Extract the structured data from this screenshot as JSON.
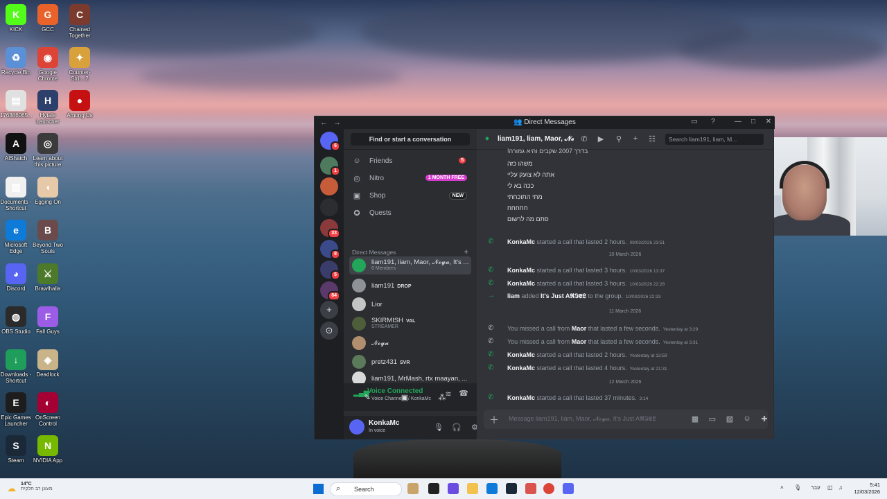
{
  "desktop": {
    "icons": [
      {
        "label": "KICK",
        "color": "#53fc18",
        "glyph": "K"
      },
      {
        "label": "GCC",
        "color": "#e8622a",
        "glyph": "G"
      },
      {
        "label": "Chained Together",
        "color": "#7a3b2e",
        "glyph": "C"
      },
      {
        "label": "Recycle Bin",
        "color": "#5b8fd6",
        "glyph": "♻"
      },
      {
        "label": "Google Chrome",
        "color": "#db4437",
        "glyph": "◉"
      },
      {
        "label": "Counter-Stri... 2",
        "color": "#d9a13b",
        "glyph": "✦"
      },
      {
        "label": "176886065...",
        "color": "#e0e0e0",
        "glyph": "▤"
      },
      {
        "label": "Hytale Launcher",
        "color": "#2d3f6b",
        "glyph": "H"
      },
      {
        "label": "Among Us",
        "color": "#c51111",
        "glyph": "●"
      },
      {
        "label": "AIShatch",
        "color": "#111111",
        "glyph": "A"
      },
      {
        "label": "Learn about this picture",
        "color": "#3b3b3b",
        "glyph": "◎"
      },
      {
        "label": "Documents - Shortcut",
        "color": "#f0f0f0",
        "glyph": "▥"
      },
      {
        "label": "Egging On",
        "color": "#e6c9a8",
        "glyph": "◖"
      },
      {
        "label": "Microsoft Edge",
        "color": "#0f7bd8",
        "glyph": "e"
      },
      {
        "label": "Beyond Two Souls",
        "color": "#6a4a4a",
        "glyph": "B"
      },
      {
        "label": "Discord",
        "color": "#5865f2",
        "glyph": "◕"
      },
      {
        "label": "Brawlhalla",
        "color": "#4c7a2a",
        "glyph": "⚔"
      },
      {
        "label": "OBS Studio",
        "color": "#2b2b2b",
        "glyph": "◍"
      },
      {
        "label": "Fall Guys",
        "color": "#9b5de5",
        "glyph": "F"
      },
      {
        "label": "Downloads - Shortcut",
        "color": "#1e9e5a",
        "glyph": "↓"
      },
      {
        "label": "Deadlock",
        "color": "#c9b48a",
        "glyph": "◈"
      },
      {
        "label": "Epic Games Launcher",
        "color": "#1d1d1d",
        "glyph": "E"
      },
      {
        "label": "OnScreen Control",
        "color": "#a50034",
        "glyph": "◐"
      },
      {
        "label": "Steam",
        "color": "#1b2838",
        "glyph": "S"
      },
      {
        "label": "NVIDIA App",
        "color": "#76b900",
        "glyph": "N"
      }
    ]
  },
  "window": {
    "title": "Direct Messages",
    "colors": {
      "accent": "#5865f2",
      "green": "#23a55a",
      "red": "#f23f43",
      "pink": "#d63ccc"
    }
  },
  "guilds": {
    "badges": [
      "6",
      "1",
      "33",
      "8",
      "5",
      "84"
    ]
  },
  "sidebar": {
    "find_label": "Find or start a conversation",
    "nav": [
      {
        "label": "Friends",
        "icon": "friends-icon",
        "badge": "5"
      },
      {
        "label": "Nitro",
        "icon": "nitro-icon",
        "badge": "1 MONTH FREE"
      },
      {
        "label": "Shop",
        "icon": "shop-icon",
        "badge": "NEW"
      },
      {
        "label": "Quests",
        "icon": "quests-icon",
        "badge": ""
      }
    ],
    "dm_header": "Direct Messages",
    "dms": [
      {
        "name": "liam191, liam, Maor, 𝓝𝓸𝔂𝓪, It's ...",
        "sub": "6 Members",
        "tag": "",
        "color": "#23a55a"
      },
      {
        "name": "liam191",
        "sub": "",
        "tag": "DROP",
        "color": "#8e9297"
      },
      {
        "name": "Lior",
        "sub": "",
        "tag": "",
        "color": "#c4c4c4"
      },
      {
        "name": "SKIRMISH",
        "sub": "STREAMER",
        "tag": "VAL",
        "color": "#4e5d3a"
      },
      {
        "name": "𝓝𝓸𝔂𝓪",
        "sub": "",
        "tag": "",
        "color": "#b08e6e"
      },
      {
        "name": "pretz431",
        "sub": "",
        "tag": "SVR",
        "color": "#5a7a5a"
      },
      {
        "name": "liam191, MrMash, rtx maayan, ...",
        "sub": "",
        "tag": "",
        "color": "#d9d9d9"
      }
    ],
    "voice": {
      "title": "Voice Connected",
      "sub": "~ Voice Channel 1 / KonkaMc"
    },
    "user": {
      "name": "KonkaMc",
      "status": "In voice"
    }
  },
  "chat": {
    "header_name": "liam191, liam, Maor, 𝓝𝓸𝔂𝓪",
    "search_placeholder": "Search liam191, liam, M...",
    "hebrew_lines": [
      "בדרך 2007 שקבים והיא גמורה!",
      "משהו כזה",
      "אתה לא צועק עליי",
      "ככה בא לי",
      "מתי התוכחתי",
      "חחחחח",
      "סתם מה לרשום"
    ],
    "events": [
      {
        "kind": "call",
        "who": "KonkaMc",
        "text": " started a call that lasted 2 hours.",
        "time": "09/03/2026 23:51"
      },
      {
        "kind": "date",
        "text": "10 March 2026"
      },
      {
        "kind": "call",
        "who": "KonkaMc",
        "text": " started a call that lasted 3 hours.",
        "time": "10/03/2026 13:37"
      },
      {
        "kind": "call",
        "who": "KonkaMc",
        "text": " started a call that lasted 3 hours.",
        "time": "10/03/2026 22:28"
      },
      {
        "kind": "add",
        "who": "liam",
        "text": " added ",
        "target": "It's Just A𝕽𝕴𝕰𝕷",
        "tail": " to the group.",
        "time": "10/03/2026 22:33"
      },
      {
        "kind": "date",
        "text": "11 March 2026"
      },
      {
        "kind": "missed",
        "who": "Maor",
        "text": "You missed a call from ",
        "tail": " that lasted a few seconds.",
        "time": "Yesterday at 3:29"
      },
      {
        "kind": "missed",
        "who": "Maor",
        "text": "You missed a call from ",
        "tail": " that lasted a few seconds.",
        "time": "Yesterday at 3:31"
      },
      {
        "kind": "call",
        "who": "KonkaMc",
        "text": " started a call that lasted 2 hours.",
        "time": "Yesterday at 13:59"
      },
      {
        "kind": "call",
        "who": "KonkaMc",
        "text": " started a call that lasted 4 hours.",
        "time": "Yesterday at 21:31"
      },
      {
        "kind": "date",
        "text": "12 March 2026"
      },
      {
        "kind": "call",
        "who": "KonkaMc",
        "text": " started a call that lasted 37 minutes.",
        "time": "3:14"
      }
    ],
    "composer_placeholder": "Message liam191, liam, Maor, 𝓝𝓸𝔂𝓪, It's Just A𝕽𝕴𝕰𝕷"
  },
  "taskbar": {
    "weather_temp": "14°C",
    "weather_desc": "מעונן רב חלקית",
    "search_label": "Search",
    "lang": "עבר",
    "time": "5:41",
    "date": "12/03/2026"
  }
}
